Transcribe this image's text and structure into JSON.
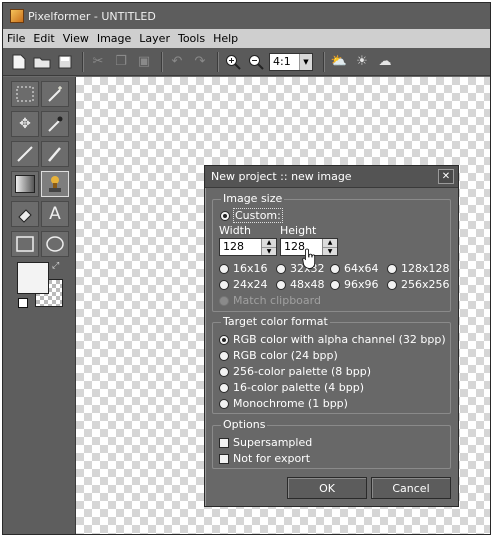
{
  "window": {
    "title": "Pixelformer - UNTITLED"
  },
  "menu": {
    "items": [
      "File",
      "Edit",
      "View",
      "Image",
      "Layer",
      "Tools",
      "Help"
    ]
  },
  "toolbar": {
    "zoom_value": "4:1"
  },
  "dialog": {
    "title": "New project :: new image",
    "image_size": {
      "group_label": "Image size",
      "custom_label": "Custom:",
      "width_label": "Width",
      "height_label": "Height",
      "width_value": "128",
      "height_value": "128",
      "presets": [
        "16x16",
        "32x32",
        "64x64",
        "128x128",
        "24x24",
        "48x48",
        "96x96",
        "256x256"
      ],
      "match_clipboard": "Match clipboard"
    },
    "color_format": {
      "group_label": "Target color format",
      "options": [
        "RGB color with alpha channel (32 bpp)",
        "RGB color (24 bpp)",
        "256-color palette (8 bpp)",
        "16-color palette (4 bpp)",
        "Monochrome (1 bpp)"
      ],
      "selected_index": 0
    },
    "options": {
      "group_label": "Options",
      "supersampled": "Supersampled",
      "not_for_export": "Not for export"
    },
    "ok_label": "OK",
    "cancel_label": "Cancel"
  },
  "colors": {
    "foreground": "#f3f3f3",
    "background": "transparent"
  }
}
